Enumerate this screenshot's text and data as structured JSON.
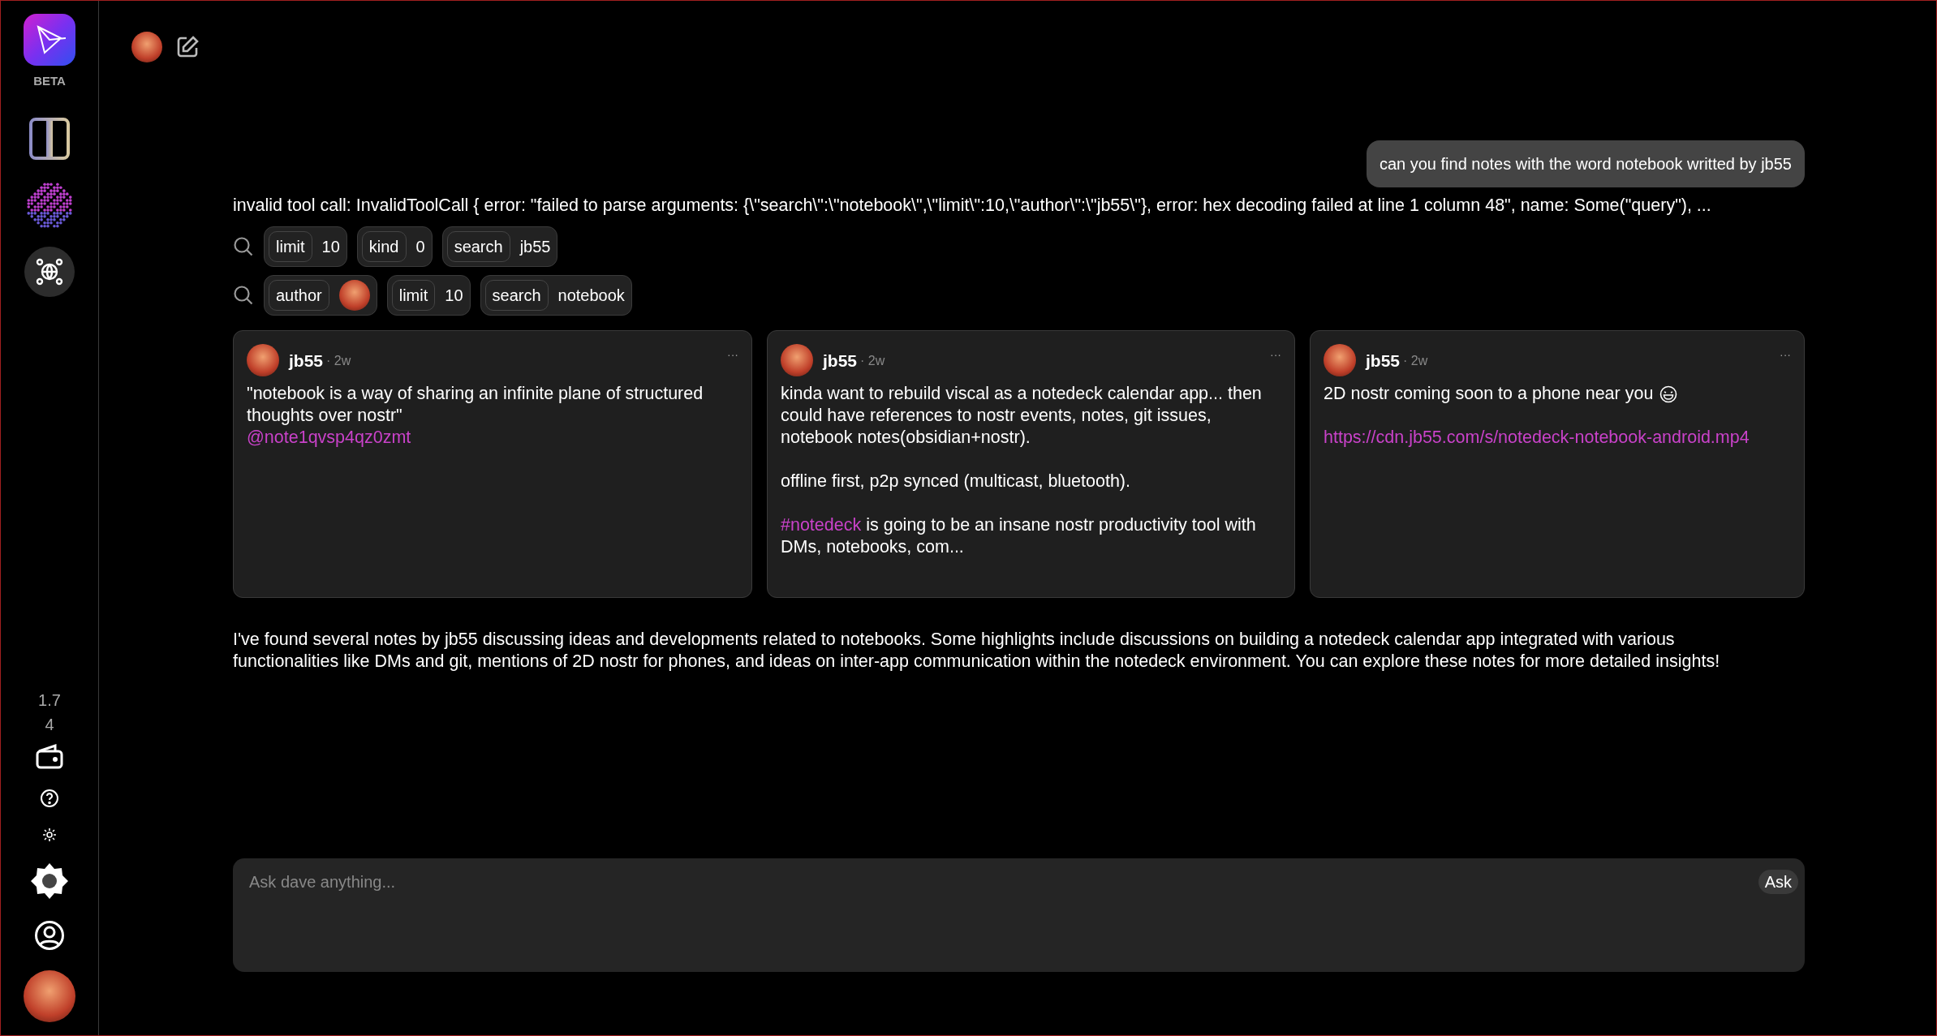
{
  "sidebar": {
    "badge": "BETA",
    "version": "1.74",
    "items": [
      {
        "kind": "columns",
        "selected": false
      },
      {
        "kind": "sphere",
        "selected": false
      },
      {
        "kind": "network",
        "selected": true
      }
    ]
  },
  "chat": {
    "user_message": "can you find notes with the word notebook writted by jb55",
    "tool_error": "invalid tool call: InvalidToolCall { error: \"failed to parse arguments: {\\\"search\\\":\\\"notebook\\\",\\\"limit\\\":10,\\\"author\\\":\\\"jb55\\\"}, error: hex decoding failed at line 1 column 48\", name: Some(\"query\"), ...",
    "tool_calls": [
      {
        "params": [
          {
            "kind": "text",
            "key": "limit",
            "value": "10"
          },
          {
            "kind": "text",
            "key": "kind",
            "value": "0"
          },
          {
            "kind": "text",
            "key": "search",
            "value": "jb55"
          }
        ]
      },
      {
        "params": [
          {
            "kind": "avatar",
            "key": "author"
          },
          {
            "kind": "text",
            "key": "limit",
            "value": "10"
          },
          {
            "kind": "text",
            "key": "search",
            "value": "notebook"
          }
        ]
      }
    ],
    "notes": [
      {
        "author": "jb55",
        "time": "· 2w",
        "menu": "···",
        "paragraphs": [
          [
            {
              "kind": "text",
              "text": "\"notebook is a way of sharing an infinite plane of structured thoughts over nostr\""
            },
            {
              "kind": "mention",
              "text": "@note1qvsp4qz0zmt"
            }
          ]
        ]
      },
      {
        "author": "jb55",
        "time": "· 2w",
        "menu": "···",
        "paragraphs": [
          [
            {
              "kind": "text",
              "text": "kinda want to rebuild viscal as a notedeck calendar app... then could have references to nostr events, notes, git issues, notebook notes(obsidian+nostr)."
            }
          ],
          [
            {
              "kind": "text",
              "text": "offline first, p2p synced (multicast, bluetooth)."
            }
          ],
          [
            {
              "kind": "hashtag",
              "text": "#notedeck"
            },
            {
              "kind": "text",
              "text": " is going to be an insane nostr productivity tool with DMs, notebooks, com..."
            }
          ]
        ]
      },
      {
        "author": "jb55",
        "time": "· 2w",
        "menu": "···",
        "paragraphs": [
          [
            {
              "kind": "text",
              "text": "2D nostr coming soon to a phone near you"
            },
            {
              "kind": "emoji"
            }
          ],
          [
            {
              "kind": "link",
              "text": "https://cdn.jb55.com/s/notedeck-notebook-android.mp4"
            }
          ]
        ]
      }
    ],
    "summary": "I've found several notes by jb55 discussing ideas and developments related to notebooks. Some highlights include discussions on building a notedeck calendar app integrated with various functionalities like DMs and git, mentions of 2D nostr for phones, and ideas on inter-app communication within the notedeck environment. You can explore these notes for more detailed insights!"
  },
  "input": {
    "placeholder": "Ask dave anything...",
    "button": "Ask"
  }
}
